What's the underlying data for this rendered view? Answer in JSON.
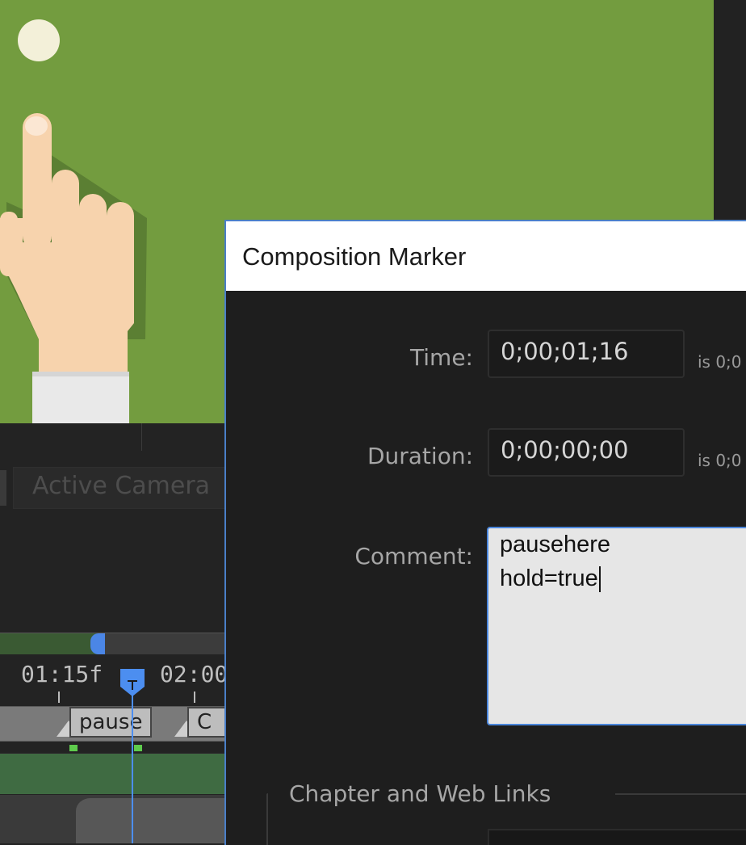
{
  "dialog": {
    "title": "Composition Marker",
    "time": {
      "label": "Time:",
      "value": "0;00;01;16",
      "note": "is 0;0"
    },
    "duration": {
      "label": "Duration:",
      "value": "0;00;00;00",
      "note": "is 0;0"
    },
    "comment": {
      "label": "Comment:",
      "lines": [
        "pausehere",
        "hold=true"
      ]
    },
    "chapter_group": {
      "label": "Chapter and Web Links"
    }
  },
  "viewer": {
    "camera_label": "Active Camera"
  },
  "timeline": {
    "ruler": [
      "01:15f",
      "02:00"
    ],
    "markers": [
      "pause",
      "C"
    ]
  },
  "colors": {
    "viewer_bg": "#739c3f",
    "accent": "#4a86dc",
    "cti": "#4c8ef0"
  }
}
